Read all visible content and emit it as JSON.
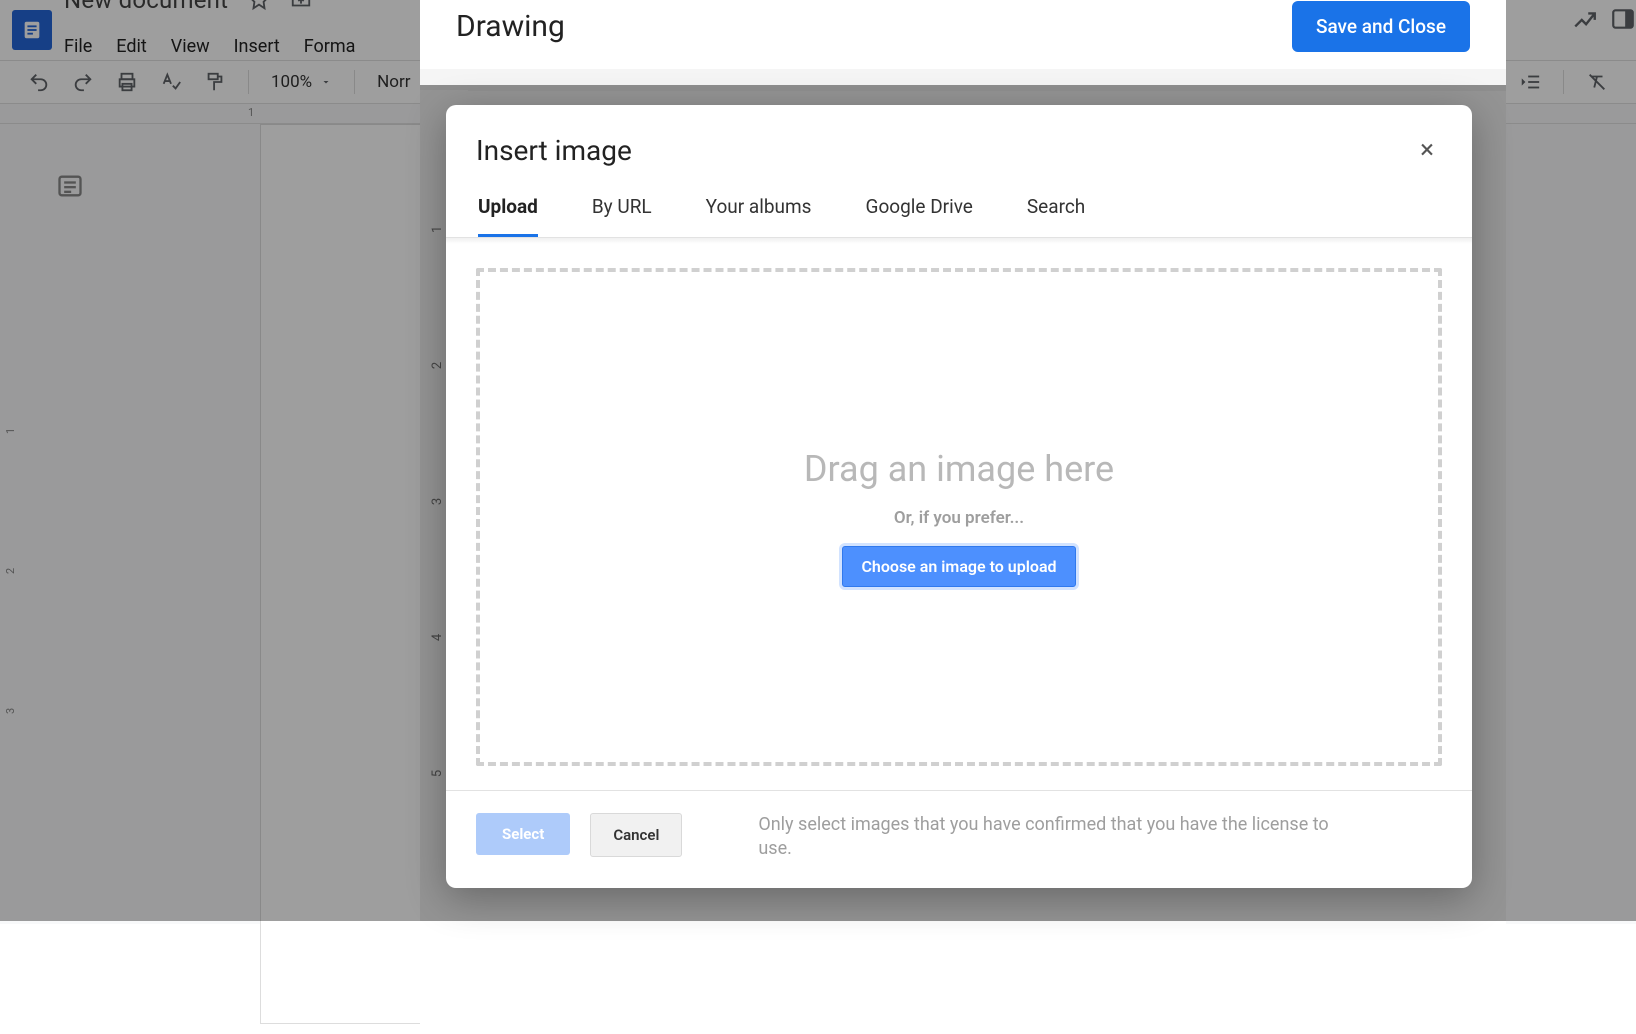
{
  "docs": {
    "title": "New document",
    "menu": {
      "file": "File",
      "edit": "Edit",
      "view": "View",
      "insert": "Insert",
      "format": "Forma"
    },
    "toolbar": {
      "zoom": "100%",
      "styles": "Norr"
    },
    "ruler": {
      "mark1": "1"
    },
    "vruler": {
      "m1": "1",
      "m2": "2",
      "m3": "3"
    }
  },
  "drawing": {
    "title": "Drawing",
    "save_close": "Save and Close",
    "canvas_ruler": {
      "m1": "1",
      "m2": "2",
      "m3": "3",
      "m4": "4",
      "m5": "5"
    }
  },
  "insert_image": {
    "title": "Insert image",
    "tabs": {
      "upload": "Upload",
      "by_url": "By URL",
      "albums": "Your albums",
      "drive": "Google Drive",
      "search": "Search"
    },
    "dropzone": {
      "headline": "Drag an image here",
      "or": "Or, if you prefer...",
      "choose": "Choose an image to upload"
    },
    "footer": {
      "select": "Select",
      "cancel": "Cancel",
      "license": "Only select images that you have confirmed that you have the license to use."
    }
  }
}
